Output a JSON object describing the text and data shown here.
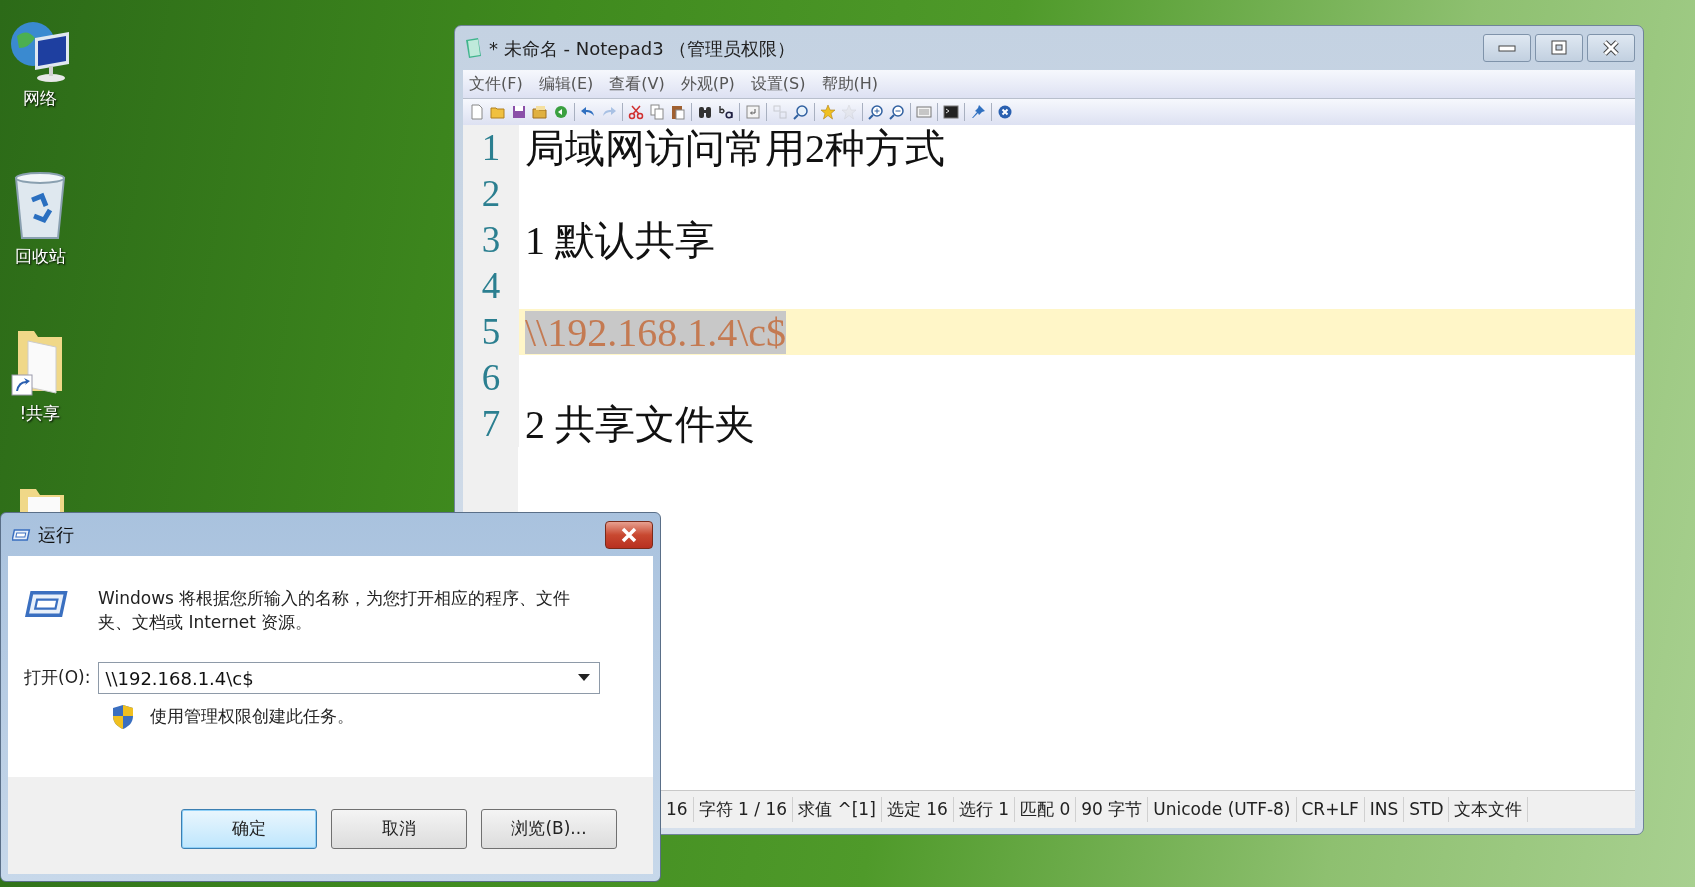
{
  "desktop_icons": [
    {
      "kind": "network",
      "label": "网络"
    },
    {
      "kind": "recycle",
      "label": "回收站"
    },
    {
      "kind": "shortcut",
      "label": "!共享"
    },
    {
      "kind": "folder"
    }
  ],
  "notepad": {
    "title": "* 未命名 - Notepad3 （管理员权限）",
    "menu": [
      "文件(F)",
      "编辑(E)",
      "查看(V)",
      "外观(P)",
      "设置(S)",
      "帮助(H)"
    ],
    "toolbar": [
      {
        "kind": "new",
        "disabled": false
      },
      {
        "kind": "open",
        "disabled": false
      },
      {
        "kind": "save",
        "disabled": false
      },
      {
        "kind": "saveas",
        "disabled": false
      },
      {
        "kind": "revert",
        "disabled": false
      },
      {
        "kind": "separator"
      },
      {
        "kind": "undo",
        "disabled": false
      },
      {
        "kind": "redo",
        "disabled": true
      },
      {
        "kind": "separator"
      },
      {
        "kind": "cut",
        "disabled": false
      },
      {
        "kind": "copy",
        "disabled": false
      },
      {
        "kind": "paste",
        "disabled": false
      },
      {
        "kind": "separator"
      },
      {
        "kind": "find",
        "disabled": false
      },
      {
        "kind": "replace",
        "disabled": false
      },
      {
        "kind": "separator"
      },
      {
        "kind": "wrap",
        "disabled": false
      },
      {
        "kind": "separator"
      },
      {
        "kind": "select",
        "disabled": true
      },
      {
        "kind": "magnifier",
        "disabled": false
      },
      {
        "kind": "separator"
      },
      {
        "kind": "star",
        "disabled": false
      },
      {
        "kind": "staradd",
        "disabled": true
      },
      {
        "kind": "separator"
      },
      {
        "kind": "zoomin",
        "disabled": false
      },
      {
        "kind": "zoomout",
        "disabled": false
      },
      {
        "kind": "separator"
      },
      {
        "kind": "view",
        "disabled": false
      },
      {
        "kind": "separator"
      },
      {
        "kind": "terminal",
        "disabled": false
      },
      {
        "kind": "separator"
      },
      {
        "kind": "pin",
        "disabled": false
      },
      {
        "kind": "separator"
      },
      {
        "kind": "exit",
        "disabled": false
      }
    ],
    "lines": [
      {
        "number": "1",
        "text": "局域网访问常用2种方式",
        "current": false,
        "selected": false
      },
      {
        "number": "2",
        "current": false,
        "selected": false
      },
      {
        "number": "3",
        "text": "1 默认共享",
        "current": false,
        "selected": false
      },
      {
        "number": "4",
        "current": false,
        "selected": false
      },
      {
        "number": "5",
        "text": "\\\\192.168.1.4\\c$",
        "current": true,
        "selected": true
      },
      {
        "number": "6",
        "current": false,
        "selected": false
      },
      {
        "number": "7",
        "text": "2 共享文件夹",
        "current": false,
        "selected": false
      }
    ],
    "status_bar": [
      "16",
      "字符 1 / 16",
      "求值 ^[1]",
      "选定 16",
      "选行 1",
      "匹配 0",
      "90 字节",
      "Unicode (UTF-8)",
      "CR+LF",
      "INS",
      "STD",
      "文本文件"
    ]
  },
  "run_dialog": {
    "title": "运行",
    "description": "Windows 将根据您所输入的名称，为您打开相应的程序、文件夹、文档或 Internet 资源。",
    "open_label": "打开(O):",
    "open_value": "\\\\192.168.1.4\\c$",
    "admin_note": "使用管理权限创建此任务。",
    "buttons": [
      {
        "label": "确定",
        "default": true
      },
      {
        "label": "取消",
        "default": false
      },
      {
        "label": "浏览(B)...",
        "default": false
      }
    ]
  }
}
